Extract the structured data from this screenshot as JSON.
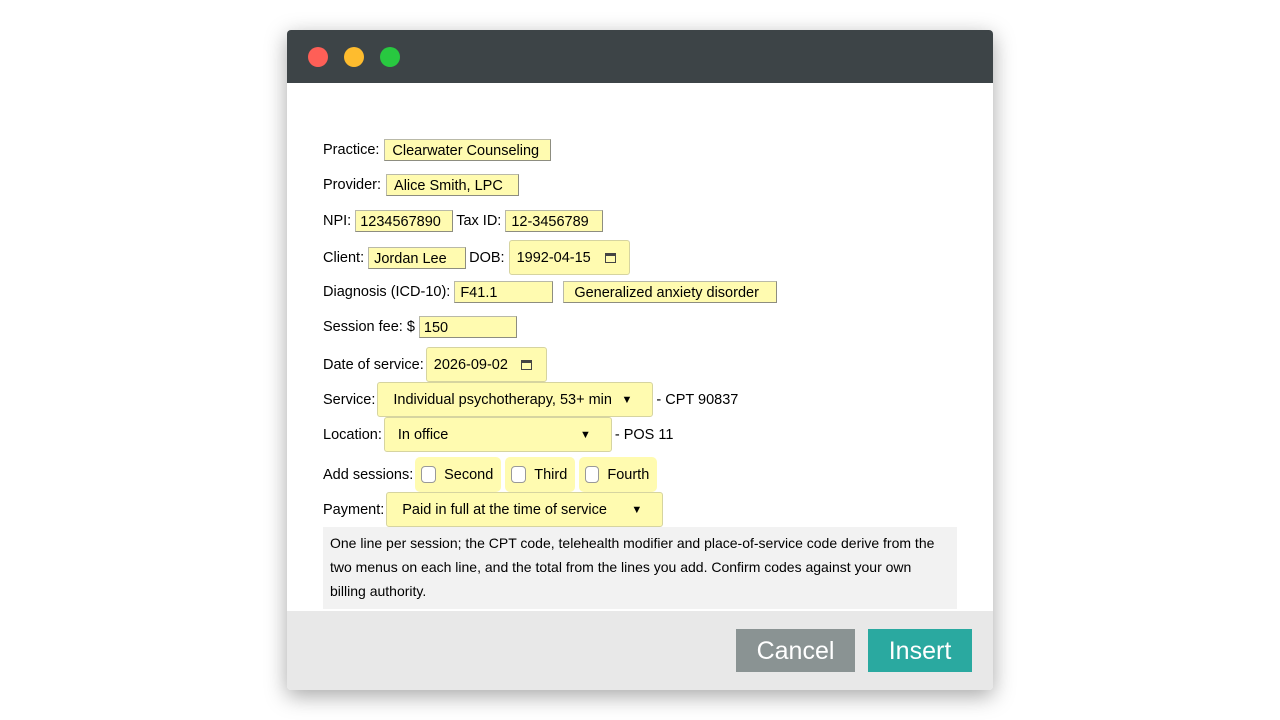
{
  "window": {
    "controls": [
      "close",
      "minimize",
      "maximize"
    ]
  },
  "form": {
    "practice": {
      "label": "Practice:",
      "value": "Clearwater Counseling"
    },
    "provider": {
      "label": "Provider:",
      "value": "Alice Smith, LPC"
    },
    "npi": {
      "label": "NPI:",
      "value": "1234567890"
    },
    "tax_id": {
      "label": "Tax ID:",
      "value": "12-3456789"
    },
    "client": {
      "label": "Client:",
      "value": "Jordan Lee"
    },
    "dob": {
      "label": "DOB:",
      "value": "1992-04-15"
    },
    "diagnosis": {
      "label": "Diagnosis (ICD-10):",
      "code": "F41.1",
      "description": "Generalized anxiety disorder"
    },
    "session_fee": {
      "label": "Session fee: $",
      "value": "150"
    },
    "date_of_service": {
      "label": "Date of service:",
      "value": "2026-09-02"
    },
    "service": {
      "label": "Service:",
      "value": "Individual psychotherapy, 53+ min",
      "suffix": "- CPT 90837"
    },
    "location": {
      "label": "Location:",
      "value": "In office",
      "suffix": "- POS 11"
    },
    "add_sessions": {
      "label": "Add sessions:",
      "options": [
        {
          "label": "Second",
          "checked": false
        },
        {
          "label": "Third",
          "checked": false
        },
        {
          "label": "Fourth",
          "checked": false
        }
      ]
    },
    "payment": {
      "label": "Payment:",
      "value": "Paid in full at the time of service"
    },
    "note": "One line per session; the CPT code, telehealth modifier and place-of-service code derive from the two menus on each line, and the total from the lines you add. Confirm codes against your own billing authority."
  },
  "footer": {
    "cancel_label": "Cancel",
    "insert_label": "Insert"
  },
  "colors": {
    "titlebar": "#3d4447",
    "field_bg": "#fffbb0",
    "cancel_bg": "#8a9393",
    "insert_bg": "#2aa9a0",
    "footer_bg": "#e8e8e8"
  },
  "icons": {
    "date_picker": "calendar-icon",
    "dropdown": "caret-down-icon"
  }
}
